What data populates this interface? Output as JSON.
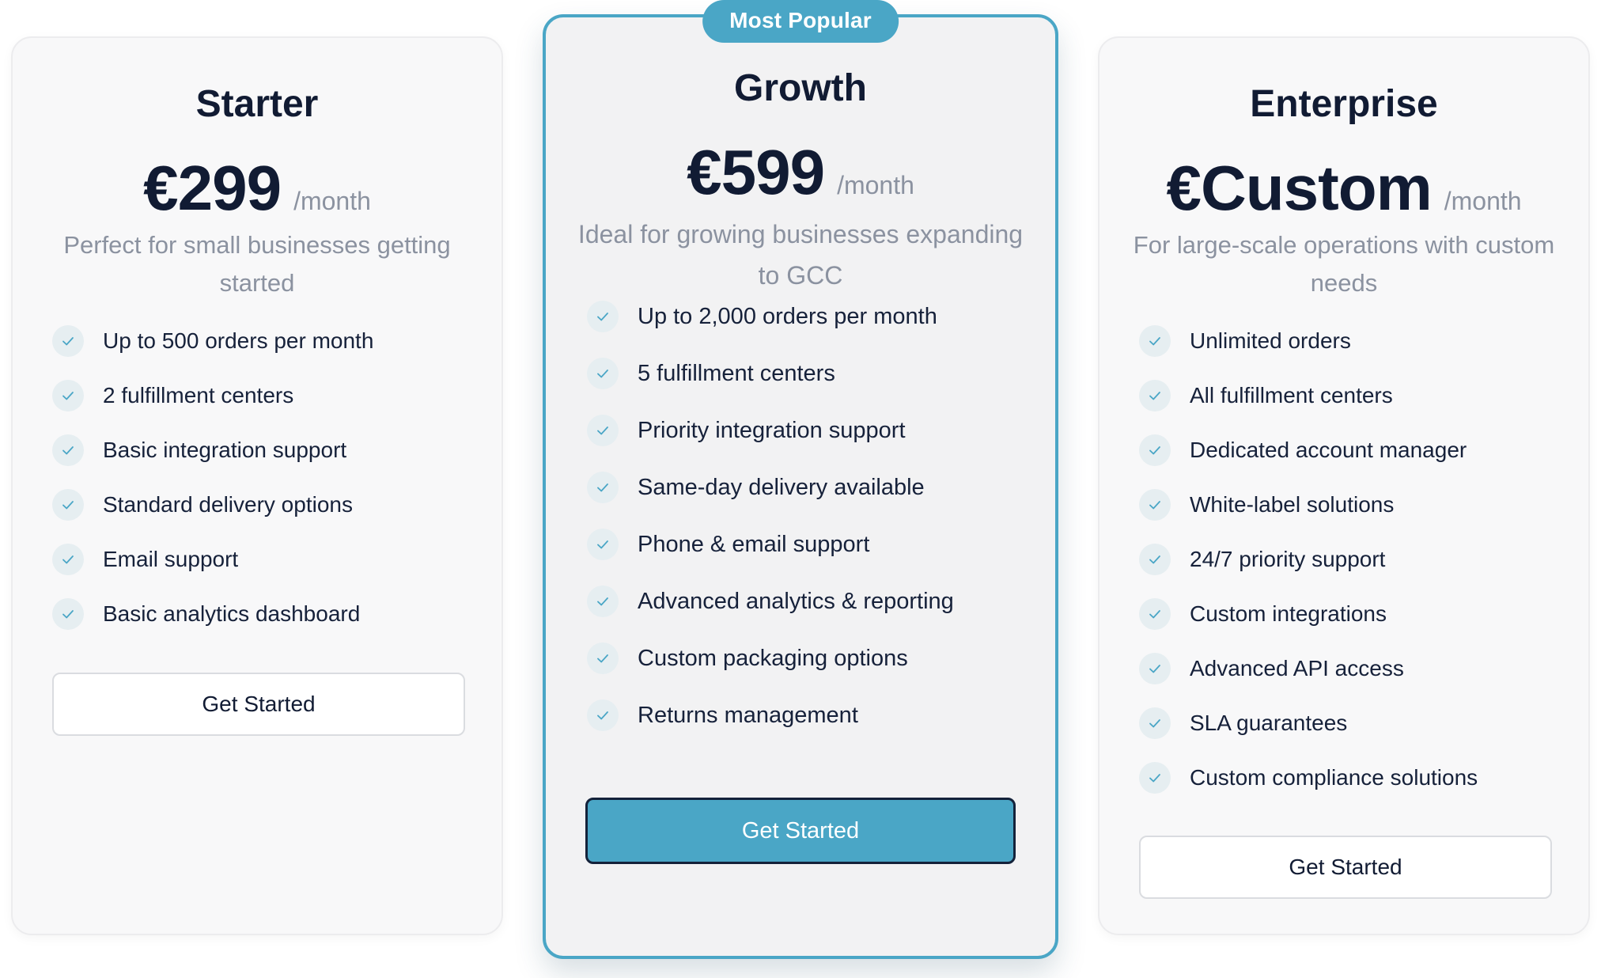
{
  "plans": {
    "starter": {
      "name": "Starter",
      "price": "€299",
      "period": "/month",
      "description": "Perfect for small businesses getting started",
      "features": [
        "Up to 500 orders per month",
        "2 fulfillment centers",
        "Basic integration support",
        "Standard delivery options",
        "Email support",
        "Basic analytics dashboard"
      ],
      "button": "Get Started"
    },
    "growth": {
      "badge": "Most Popular",
      "name": "Growth",
      "price": "€599",
      "period": "/month",
      "description": "Ideal for growing businesses expanding to GCC",
      "features": [
        "Up to 2,000 orders per month",
        "5 fulfillment centers",
        "Priority integration support",
        "Same-day delivery available",
        "Phone & email support",
        "Advanced analytics & reporting",
        "Custom packaging options",
        "Returns management"
      ],
      "button": "Get Started"
    },
    "enterprise": {
      "name": "Enterprise",
      "price": "€Custom",
      "period": "/month",
      "description": "For large-scale operations with custom needs",
      "features": [
        "Unlimited orders",
        "All fulfillment centers",
        "Dedicated account manager",
        "White-label solutions",
        "24/7 priority support",
        "Custom integrations",
        "Advanced API access",
        "SLA guarantees",
        "Custom compliance solutions"
      ],
      "button": "Get Started"
    }
  },
  "icons": {
    "feature_check": "check-icon"
  },
  "colors": {
    "accent": "#4aa6c6",
    "text": "#111b33",
    "muted": "#8b92a0"
  }
}
